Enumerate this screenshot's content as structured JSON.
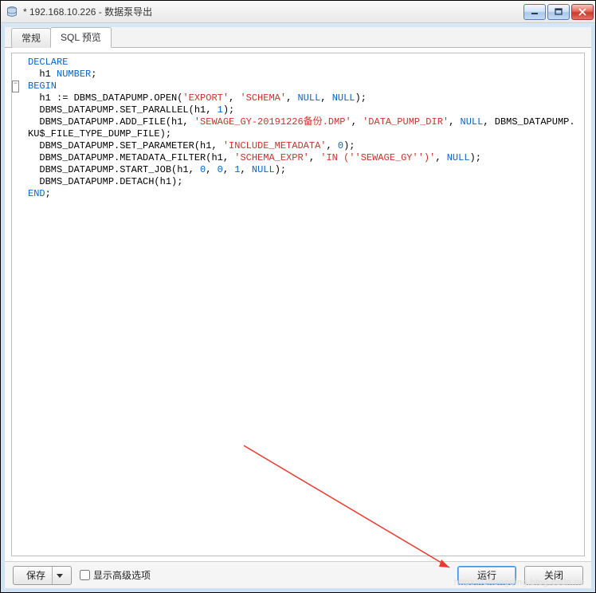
{
  "window": {
    "title": "* 192.168.10.226 - 数据泵导出"
  },
  "tabs": [
    {
      "label": "常规",
      "active": false
    },
    {
      "label": "SQL 预览",
      "active": true
    }
  ],
  "code": {
    "tokens": [
      [
        {
          "t": "DECLARE",
          "c": "kw"
        }
      ],
      [
        {
          "t": "  h1 ",
          "c": ""
        },
        {
          "t": "NUMBER",
          "c": "kw"
        },
        {
          "t": ";",
          "c": ""
        }
      ],
      [
        {
          "t": "BEGIN",
          "c": "kw"
        }
      ],
      [
        {
          "t": "  h1 := DBMS_DATAPUMP.OPEN(",
          "c": ""
        },
        {
          "t": "'EXPORT'",
          "c": "str"
        },
        {
          "t": ", ",
          "c": ""
        },
        {
          "t": "'SCHEMA'",
          "c": "str"
        },
        {
          "t": ", ",
          "c": ""
        },
        {
          "t": "NULL",
          "c": "kw"
        },
        {
          "t": ", ",
          "c": ""
        },
        {
          "t": "NULL",
          "c": "kw"
        },
        {
          "t": ");",
          "c": ""
        }
      ],
      [
        {
          "t": "  DBMS_DATAPUMP.SET_PARALLEL(h1, ",
          "c": ""
        },
        {
          "t": "1",
          "c": "num"
        },
        {
          "t": ");",
          "c": ""
        }
      ],
      [
        {
          "t": "  DBMS_DATAPUMP.ADD_FILE(h1, ",
          "c": ""
        },
        {
          "t": "'SEWAGE_GY-20191226备份.DMP'",
          "c": "str"
        },
        {
          "t": ", ",
          "c": ""
        },
        {
          "t": "'DATA_PUMP_DIR'",
          "c": "str"
        },
        {
          "t": ", ",
          "c": ""
        },
        {
          "t": "NULL",
          "c": "kw"
        },
        {
          "t": ", DBMS_DATAPUMP.",
          "c": ""
        }
      ],
      [
        {
          "t": "KU$_FILE_TYPE_DUMP_FILE);",
          "c": ""
        }
      ],
      [
        {
          "t": "  DBMS_DATAPUMP.SET_PARAMETER(h1, ",
          "c": ""
        },
        {
          "t": "'INCLUDE_METADATA'",
          "c": "str"
        },
        {
          "t": ", ",
          "c": ""
        },
        {
          "t": "0",
          "c": "num"
        },
        {
          "t": ");",
          "c": ""
        }
      ],
      [
        {
          "t": "  DBMS_DATAPUMP.METADATA_FILTER(h1, ",
          "c": ""
        },
        {
          "t": "'SCHEMA_EXPR'",
          "c": "str"
        },
        {
          "t": ", ",
          "c": ""
        },
        {
          "t": "'IN (''SEWAGE_GY'')'",
          "c": "str"
        },
        {
          "t": ", ",
          "c": ""
        },
        {
          "t": "NULL",
          "c": "kw"
        },
        {
          "t": ");",
          "c": ""
        }
      ],
      [
        {
          "t": "  DBMS_DATAPUMP.START_JOB(h1, ",
          "c": ""
        },
        {
          "t": "0",
          "c": "num"
        },
        {
          "t": ", ",
          "c": ""
        },
        {
          "t": "0",
          "c": "num"
        },
        {
          "t": ", ",
          "c": ""
        },
        {
          "t": "1",
          "c": "num"
        },
        {
          "t": ", ",
          "c": ""
        },
        {
          "t": "NULL",
          "c": "kw"
        },
        {
          "t": ");",
          "c": ""
        }
      ],
      [
        {
          "t": "  DBMS_DATAPUMP.DETACH(h1);",
          "c": ""
        }
      ],
      [
        {
          "t": "END",
          "c": "kw"
        },
        {
          "t": ";",
          "c": ""
        }
      ]
    ]
  },
  "footer": {
    "save_label": "保存",
    "advanced_label": "显示高级选项",
    "run_label": "运行",
    "close_label": "关闭"
  },
  "watermark": "https://zhengqing.blog.csdn.ne"
}
